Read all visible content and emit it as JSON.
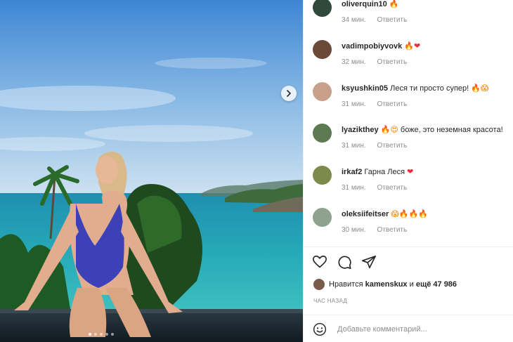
{
  "post": {
    "carousel": {
      "slides": 5,
      "active_index": 0
    }
  },
  "comments": [
    {
      "username": "oliverquin10",
      "text": "",
      "emojis": [
        {
          "glyph": "🔥",
          "kind": "fire"
        }
      ],
      "time": "34 мин.",
      "reply": "Ответить",
      "avatar_color": "#2f4a3a"
    },
    {
      "username": "vadimpobiyvovk",
      "text": "",
      "emojis": [
        {
          "glyph": "🔥",
          "kind": "fire"
        },
        {
          "glyph": "❤",
          "kind": "heart"
        }
      ],
      "time": "32 мин.",
      "reply": "Ответить",
      "avatar_color": "#6b4a3a"
    },
    {
      "username": "ksyushkin05",
      "text": "Леся ти просто супер!",
      "emojis": [
        {
          "glyph": "🔥",
          "kind": "fire"
        },
        {
          "glyph": "😱",
          "kind": "fire"
        }
      ],
      "time": "31 мин.",
      "reply": "Ответить",
      "avatar_color": "#c9a08a"
    },
    {
      "username": "lyazikthey",
      "text": "",
      "emojis": [
        {
          "glyph": "🔥",
          "kind": "fire"
        },
        {
          "glyph": "😍",
          "kind": "fire"
        }
      ],
      "after_text": "боже, это неземная красота!",
      "time": "31 мин.",
      "reply": "Ответить",
      "avatar_color": "#5d7a52"
    },
    {
      "username": "irkaf2",
      "text": "Гарна Леся",
      "emojis": [
        {
          "glyph": "❤",
          "kind": "heart"
        }
      ],
      "time": "31 мин.",
      "reply": "Ответить",
      "avatar_color": "#7c8a4a"
    },
    {
      "username": "oleksiifeitser",
      "text": "",
      "emojis": [
        {
          "glyph": "😱",
          "kind": "fire"
        },
        {
          "glyph": "🔥",
          "kind": "fire"
        },
        {
          "glyph": "🔥",
          "kind": "fire"
        },
        {
          "glyph": "🔥",
          "kind": "fire"
        }
      ],
      "time": "30 мин.",
      "reply": "Ответить",
      "avatar_color": "#8fa28f"
    }
  ],
  "likes": {
    "prefix": "Нравится",
    "user": "kamenskux",
    "middle": "и",
    "others": "ещё 47 986"
  },
  "posted_time": "ЧАС НАЗАД",
  "add_comment": {
    "placeholder": "Добавьте комментарий..."
  },
  "icons": {
    "like": "heart-outline-icon",
    "comment": "comment-bubble-icon",
    "share": "paper-plane-icon",
    "emoji": "smiley-icon",
    "next": "chevron-right-icon"
  },
  "colors": {
    "text": "#262626",
    "secondary": "#8e8e8e",
    "heart": "#ed2b3a",
    "fire": "#f57c00"
  }
}
